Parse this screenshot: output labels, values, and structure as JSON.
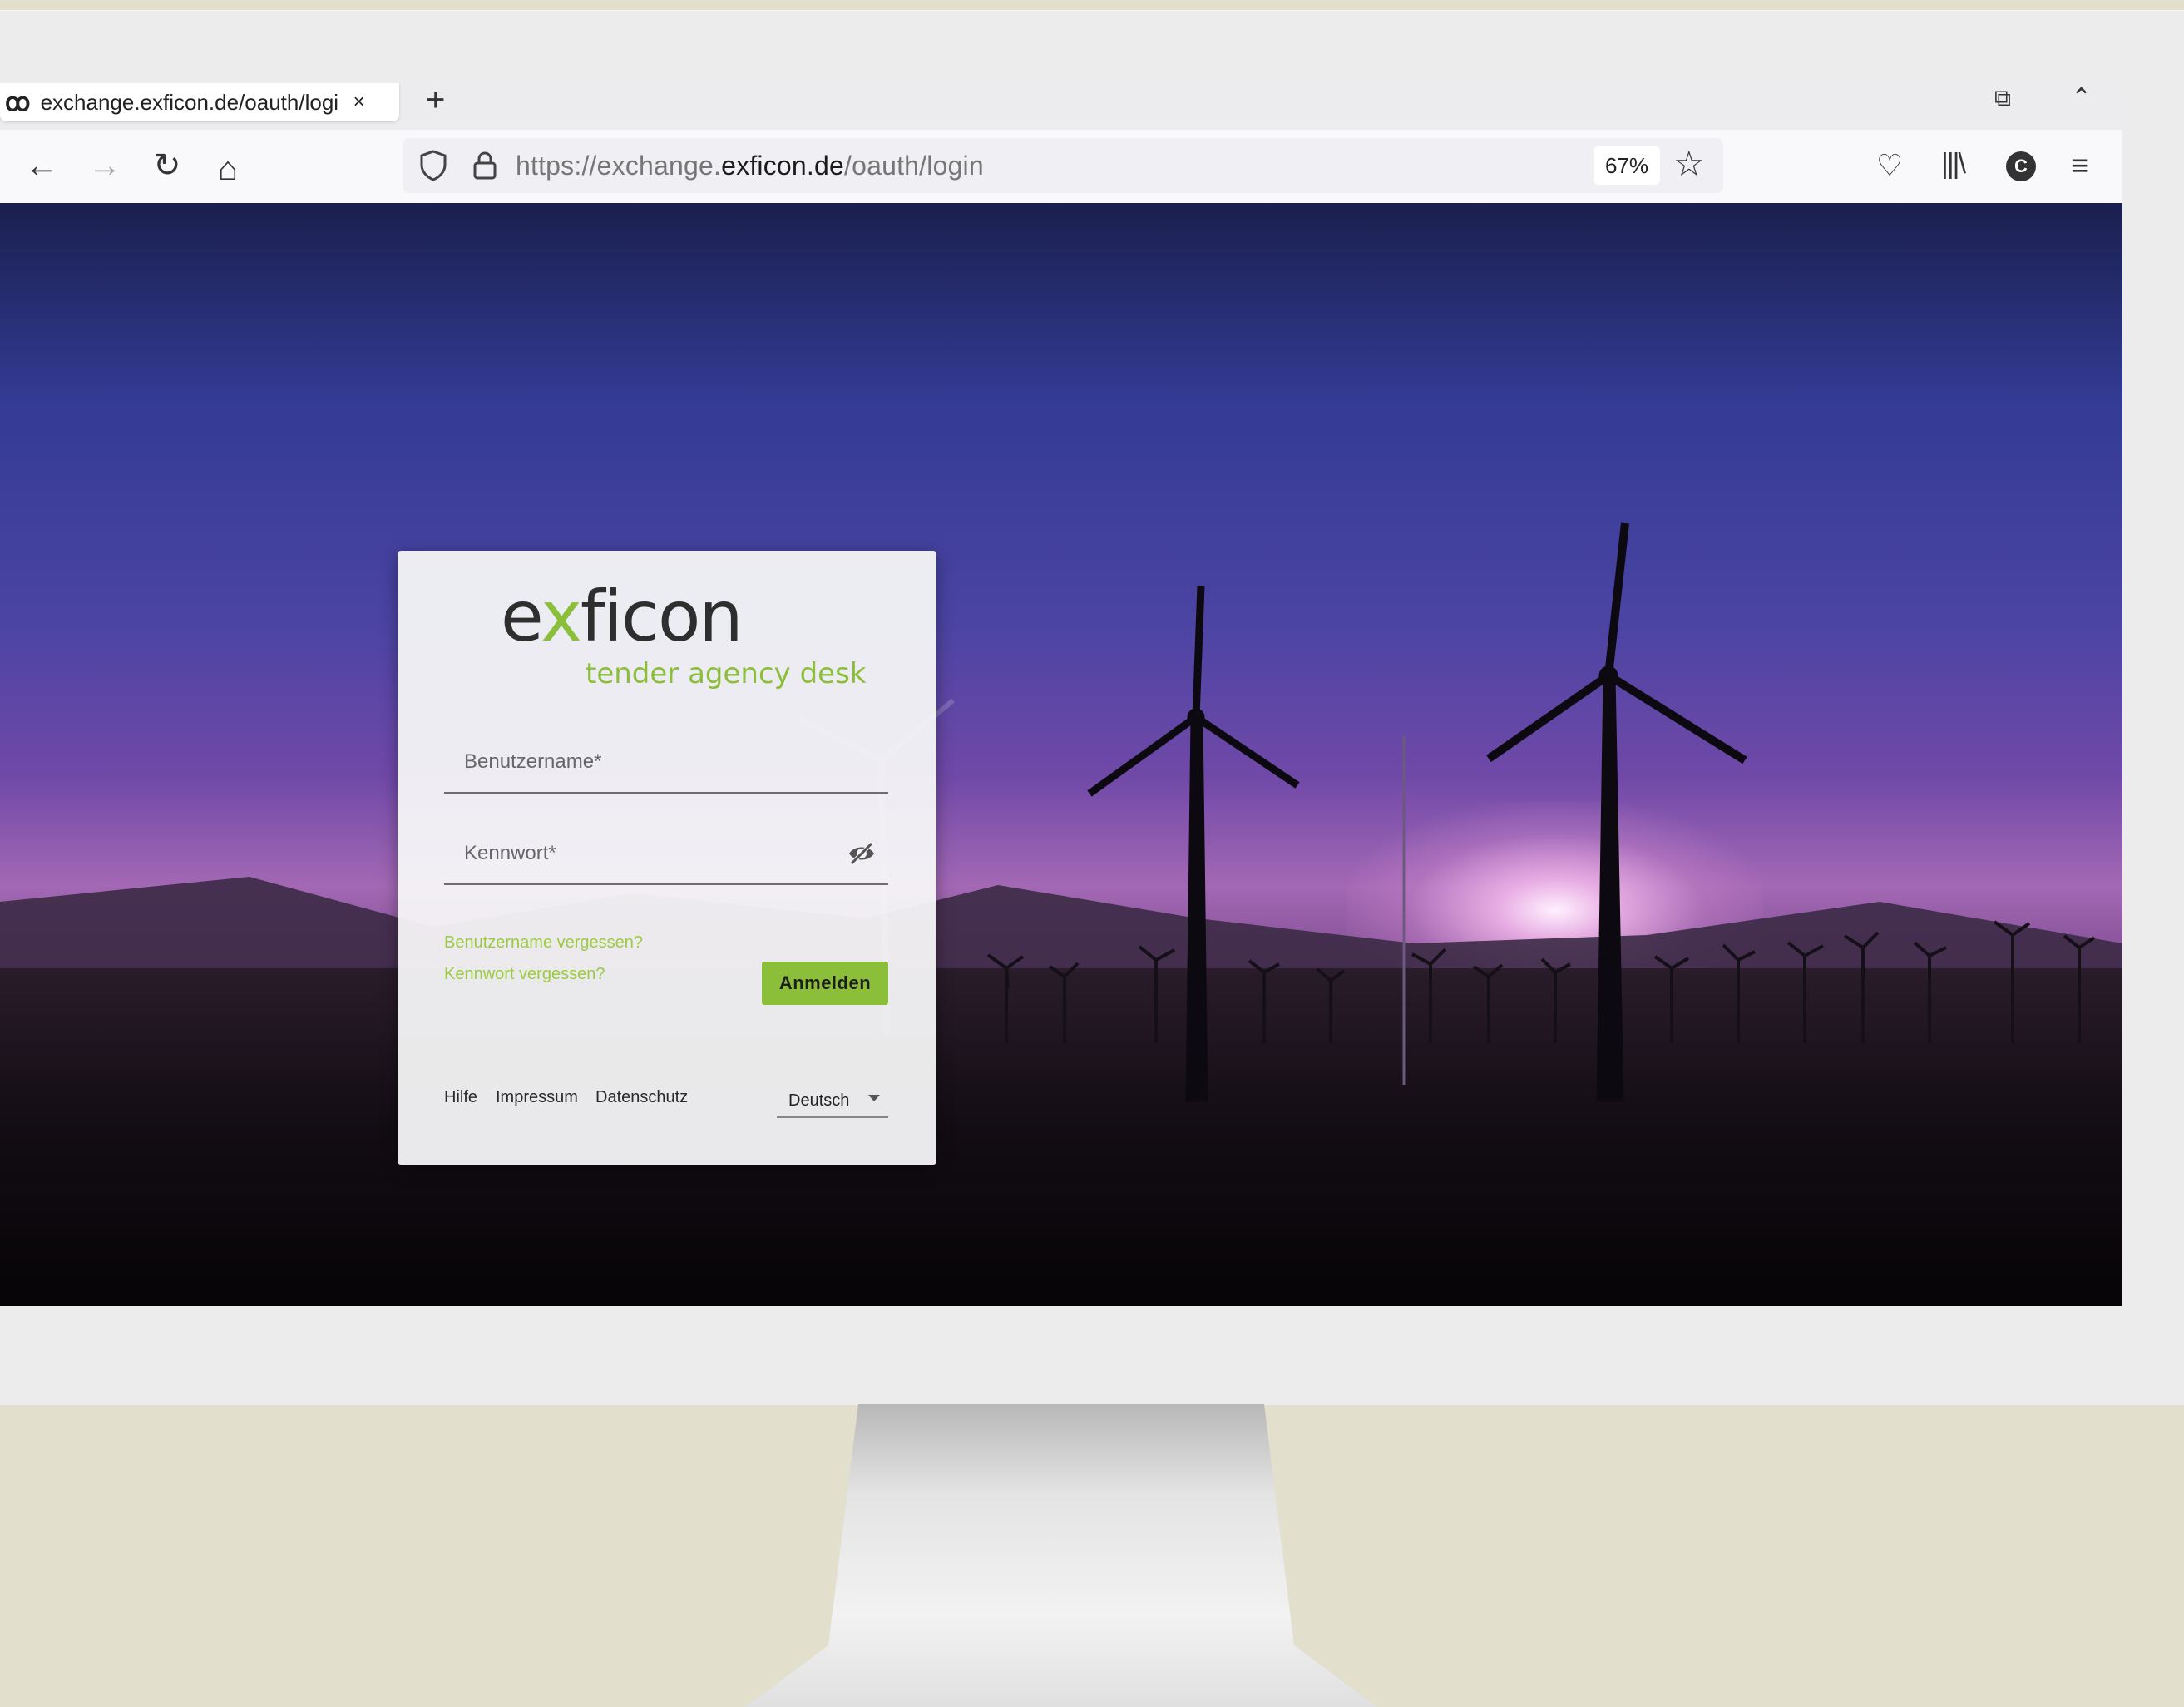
{
  "browser": {
    "tab": {
      "favicon": "ꝏ",
      "title": "exchange.exficon.de/oauth/logi",
      "close": "×"
    },
    "new_tab": "+",
    "nav": {
      "back": "←",
      "forward": "→",
      "reload": "↻",
      "home": "⌂"
    },
    "url": {
      "prefix": "https://exchange.",
      "domain": "exficon.de",
      "path": "/oauth/login"
    },
    "zoom": "67%",
    "bookmark": "☆",
    "pocket": "♡",
    "library": "|||\\",
    "account_initial": "C",
    "menu": "≡",
    "restore": "⧉",
    "collapse": "⌃"
  },
  "login": {
    "logo": {
      "e": "e",
      "x": "x",
      "rest": "ficon",
      "tagline": "tender agency desk"
    },
    "username_label": "Benutzername*",
    "password_label": "Kennwort*",
    "forgot_username": "Benutzername vergessen?",
    "forgot_password": "Kennwort vergessen?",
    "submit": "Anmelden",
    "footer": {
      "help": "Hilfe",
      "imprint": "Impressum",
      "privacy": "Datenschutz"
    },
    "language": "Deutsch"
  },
  "colors": {
    "accent_green": "#8bbf3a",
    "sky_violet": "#4b44a3"
  }
}
